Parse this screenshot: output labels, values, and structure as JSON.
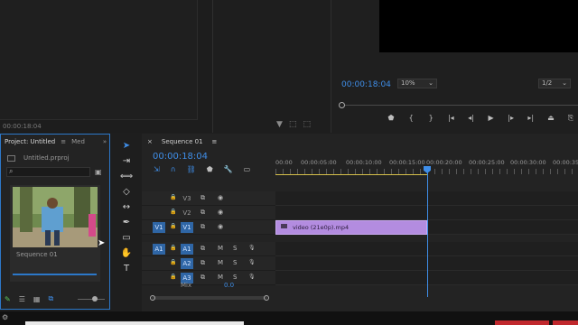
{
  "source": {
    "timecode": "00:00:18:04"
  },
  "program": {
    "timecode": "00:00:18:04",
    "zoom": "10%",
    "resolution": "1/2",
    "transport_icons": [
      "marker-icon",
      "mark-in-icon",
      "mark-out-icon",
      "go-to-in-icon",
      "step-back-icon",
      "play-icon",
      "step-forward-icon",
      "go-to-out-icon",
      "lift-icon",
      "extract-icon"
    ]
  },
  "project": {
    "tab_label": "Project: Untitled",
    "tab2_label": "Med",
    "file_name": "Untitled.prproj",
    "item_label": "Sequence 01"
  },
  "timeline": {
    "tab_label": "Sequence 01",
    "timecode": "00:00:18:04",
    "ruler": [
      "00:00",
      "00:00:05:00",
      "00:00:10:00",
      "00:00:15:00",
      "00:00:20:00",
      "00:00:25:00",
      "00:00:30:00",
      "00:00:35"
    ],
    "tracks": [
      {
        "name": "V3",
        "buttons": [
          "lock-icon",
          "sync-icon",
          "eye-icon"
        ]
      },
      {
        "name": "V2",
        "buttons": [
          "lock-icon",
          "sync-icon",
          "eye-icon"
        ]
      },
      {
        "name": "V1",
        "source": "V1",
        "buttons": [
          "lock-icon",
          "sync-icon",
          "eye-icon"
        ]
      },
      {
        "name": "A1",
        "source": "A1",
        "m": "M",
        "s": "S"
      },
      {
        "name": "A2",
        "m": "M",
        "s": "S"
      },
      {
        "name": "A3",
        "m": "M",
        "s": "S"
      }
    ],
    "clip_label": "video (21e0p).mp4",
    "mix_label": "Mix",
    "mix_value": "0.0"
  },
  "colors": {
    "accent": "#3f8ee8",
    "clip": "#b38ce0",
    "panel": "#232323",
    "workarea": "#d6c04a"
  }
}
